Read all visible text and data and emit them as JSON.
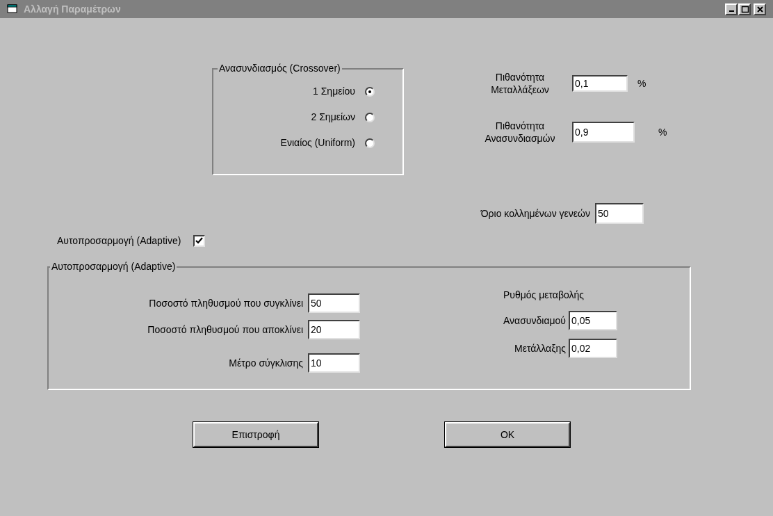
{
  "window": {
    "title": "Αλλαγή Παραμέτρων"
  },
  "crossover": {
    "legend": "Ανασυνδιασμός (Crossover)",
    "options": [
      {
        "label": "1 Σημείου",
        "selected": true
      },
      {
        "label": "2 Σημείων",
        "selected": false
      },
      {
        "label": "Ενιαίος (Uniform)",
        "selected": false
      }
    ]
  },
  "probabilities": [
    {
      "label": "Πιθανότητα Μεταλλάξεων",
      "value": "0,1",
      "unit": "%"
    },
    {
      "label": "Πιθανότητα Ανασυνδιασμών",
      "value": "0,9",
      "unit": "%"
    }
  ],
  "stuck_generations": {
    "label": "Όριο κολλημένων γενεών",
    "value": "50"
  },
  "adaptive_toggle": {
    "label": "Αυτοπροσαρμογή (Adaptive)",
    "checked": true
  },
  "adaptive_group": {
    "legend": "Αυτοπροσαρμογή (Adaptive)",
    "left": [
      {
        "label": "Ποσοστό πληθυσμού που συγκλίνει",
        "value": "50"
      },
      {
        "label": "Ποσοστό πληθυσμού που αποκλίνει",
        "value": "20"
      },
      {
        "label": "Μέτρο σύγκλισης",
        "value": "10"
      }
    ],
    "right_title": "Ρυθμός μεταβολής",
    "right": [
      {
        "label": "Ανασυνδιαμού",
        "value": "0,05"
      },
      {
        "label": "Μετάλλαξης",
        "value": "0,02"
      }
    ]
  },
  "buttons": [
    "Επιστροφή",
    "OK"
  ]
}
